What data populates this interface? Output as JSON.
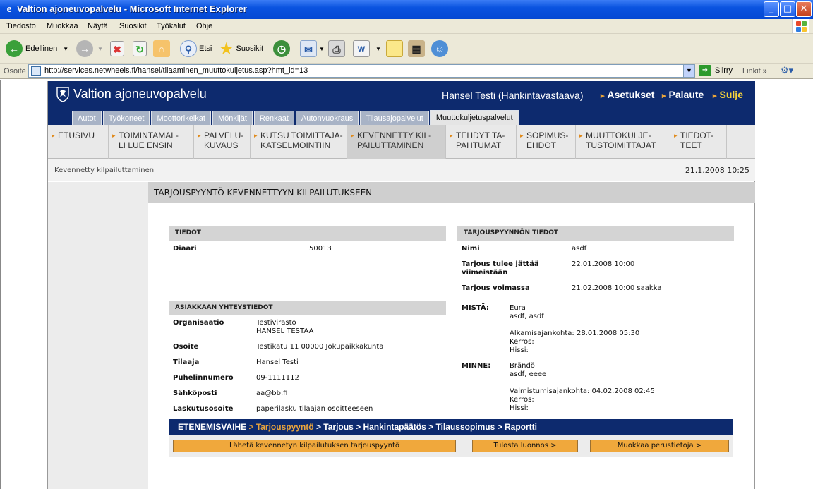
{
  "window": {
    "title": "Valtion ajoneuvopalvelu - Microsoft Internet Explorer",
    "min": "_",
    "max": "□",
    "close": "✕"
  },
  "menu": [
    "Tiedosto",
    "Muokkaa",
    "Näytä",
    "Suosikit",
    "Työkalut",
    "Ohje"
  ],
  "toolbar": {
    "back": "Edellinen",
    "search": "Etsi",
    "favorites": "Suosikit"
  },
  "address": {
    "label": "Osoite",
    "url": "http://services.netwheels.fi/hansel/tilaaminen_muuttokuljetus.asp?hmt_id=13",
    "go": "Siirry",
    "links": "Linkit"
  },
  "site": {
    "name": "Valtion ajoneuvopalvelu",
    "user": "Hansel Testi (Hankintavastaava)",
    "header_links": [
      "Asetukset",
      "Palaute",
      "Sulje"
    ],
    "header_link_colors": [
      "#ffffff",
      "#ffffff",
      "#f5d33a"
    ],
    "tabs": [
      "Autot",
      "Työkoneet",
      "Moottorikelkat",
      "Mönkijät",
      "Renkaat",
      "Autonvuokraus",
      "Tilausajopalvelut",
      "Muuttokuljetuspalvelut"
    ],
    "active_tab": 7,
    "nav": [
      "ETUSIVU",
      "TOIMINTAMAL-\nLI LUE ENSIN",
      "PALVELU-\nKUVAUS",
      "KUTSU TOIMITTAJA-\nKATSELMOINTIIN",
      "KEVENNETTY KIL-\nPAILUTTAMINEN",
      "TEHDYT TA-\nPAHTUMAT",
      "SOPIMUS-\nEHDOT",
      "MUUTTOKULJE-\nTUSTOIMITTAJAT",
      "TIEDOT-\nTEET"
    ],
    "active_nav": 4,
    "breadcrumb": "Kevennetty kilpailuttaminen",
    "datetime": "21.1.2008 10:25",
    "page_title": "TARJOUSPYYNTÖ KEVENNETTYYN KILPAILUTUKSEEN"
  },
  "tiedot": {
    "heading": "TIEDOT",
    "diaari_label": "Diaari",
    "diaari_value": "50013"
  },
  "asiakas": {
    "heading": "ASIAKKAAN YHTEYSTIEDOT",
    "rows": [
      {
        "label": "Organisaatio",
        "value": "Testivirasto\nHANSEL TESTAA"
      },
      {
        "label": "Osoite",
        "value": "Testikatu 11 00000 Jokupaikkakunta"
      },
      {
        "label": "Tilaaja",
        "value": "Hansel Testi"
      },
      {
        "label": "Puhelinnumero",
        "value": "09-1111112"
      },
      {
        "label": "Sähköposti",
        "value": "aa@bb.fi"
      },
      {
        "label": "Laskutusosoite",
        "value": "paperilasku tilaajan osoitteeseen"
      }
    ]
  },
  "tarjous": {
    "heading": "TARJOUSPYYNNÖN TIEDOT",
    "rows": [
      {
        "label": "Nimi",
        "value": "asdf"
      },
      {
        "label": "Tarjous tulee jättää\nviimeistään",
        "value": "22.01.2008 10:00"
      },
      {
        "label": "Tarjous voimassa",
        "value": "21.02.2008 10:00 saakka"
      }
    ],
    "mista_label": "MISTÄ:",
    "mista_value": "Eura\nasdf, asdf\n\nAlkamisajankohta: 28.01.2008 05:30\nKerros:\nHissi:",
    "minne_label": "MINNE:",
    "minne_value": "Brändö\nasdf, eeee\n\nValmistumisajankohta: 04.02.2008 02:45\nKerros:\nHissi:"
  },
  "progress": {
    "label": "ETENEMISVAIHE",
    "sep": " > ",
    "steps": [
      "Tarjouspyyntö",
      "Tarjous",
      "Hankintapäätös",
      "Tilaussopimus",
      "Raportti"
    ],
    "current": 0,
    "current_color": "#e9a43d"
  },
  "buttons": {
    "send": "Lähetä kevennetyn kilpailutuksen tarjouspyyntö",
    "print": "Tulosta luonnos >",
    "edit": "Muokkaa perustietoja >"
  },
  "colors": {
    "header": "#0d2a6e",
    "accent": "#e08a1a",
    "button": "#f0a83c"
  }
}
